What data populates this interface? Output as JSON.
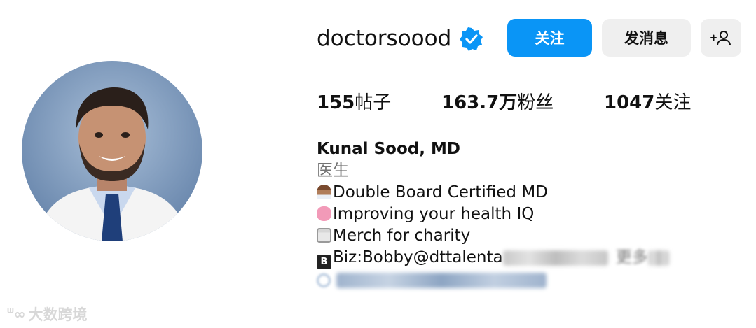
{
  "profile": {
    "username": "doctorsoood",
    "verified": true,
    "accent_color": "#0a95f6"
  },
  "actions": {
    "follow_label": "关注",
    "message_label": "发消息",
    "add_user_icon": "add-user-icon"
  },
  "stats": {
    "posts_count": "155",
    "posts_label": "帖子",
    "followers_count": "163.7万",
    "followers_label": "粉丝",
    "following_count": "1047",
    "following_label": "关注"
  },
  "bio": {
    "name": "Kunal Sood, MD",
    "category": "医生",
    "lines": [
      "Double Board Certified MD",
      "Improving your health IQ",
      "Merch for charity",
      "Biz:Bobby@dttalenta"
    ],
    "line_icons": [
      "doctor-emoji-icon",
      "brain-emoji-icon",
      "hospital-emoji-icon",
      "b-button-emoji-icon"
    ],
    "more_label": "更多",
    "link_icon": "link-icon"
  },
  "watermark": {
    "text": "大数跨境"
  }
}
